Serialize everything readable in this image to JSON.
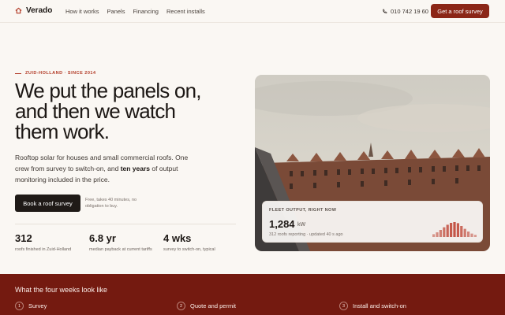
{
  "nav": {
    "brand": "Verado",
    "links": [
      "How it works",
      "Panels",
      "Financing",
      "Recent installs"
    ],
    "phone": "010 742 19 60",
    "cta": "Get a roof survey"
  },
  "hero": {
    "eyebrow": "ZUID-HOLLAND · SINCE 2014",
    "headline": "We put the panels on, and then we watch them work.",
    "subcopy_before": "Rooftop solar for houses and small commercial roofs. One crew from survey to switch-on, and ",
    "subcopy_bold": "ten years",
    "subcopy_after": " of output monitoring included in the price.",
    "cta": "Book a roof survey",
    "cta_note": "Free, takes 40 minutes, no obligation to buy.",
    "stats": [
      {
        "value": "312",
        "label": "roofs finished in Zuid-Holland"
      },
      {
        "value": "6.8 yr",
        "label": "median payback at current tariffs"
      },
      {
        "value": "4 wks",
        "label": "survey to switch-on, typical"
      }
    ]
  },
  "fleet": {
    "label": "FLEET OUTPUT, RIGHT NOW",
    "value": "1,284",
    "unit": "kW",
    "meta": "312 roofs reporting · updated 40 s ago",
    "sparkline": [
      0.18,
      0.3,
      0.45,
      0.62,
      0.78,
      0.9,
      0.95,
      0.88,
      0.7,
      0.52,
      0.35,
      0.22,
      0.14
    ],
    "colors": {
      "bar": "#c0493a"
    }
  },
  "process": {
    "title": "What the four weeks look like",
    "steps": [
      {
        "num": "1",
        "label": "Survey"
      },
      {
        "num": "2",
        "label": "Quote and permit"
      },
      {
        "num": "3",
        "label": "Install and switch-on"
      }
    ]
  },
  "colors": {
    "accent": "#8b2617",
    "band": "#741a10",
    "eyebrow": "#b23a26"
  }
}
